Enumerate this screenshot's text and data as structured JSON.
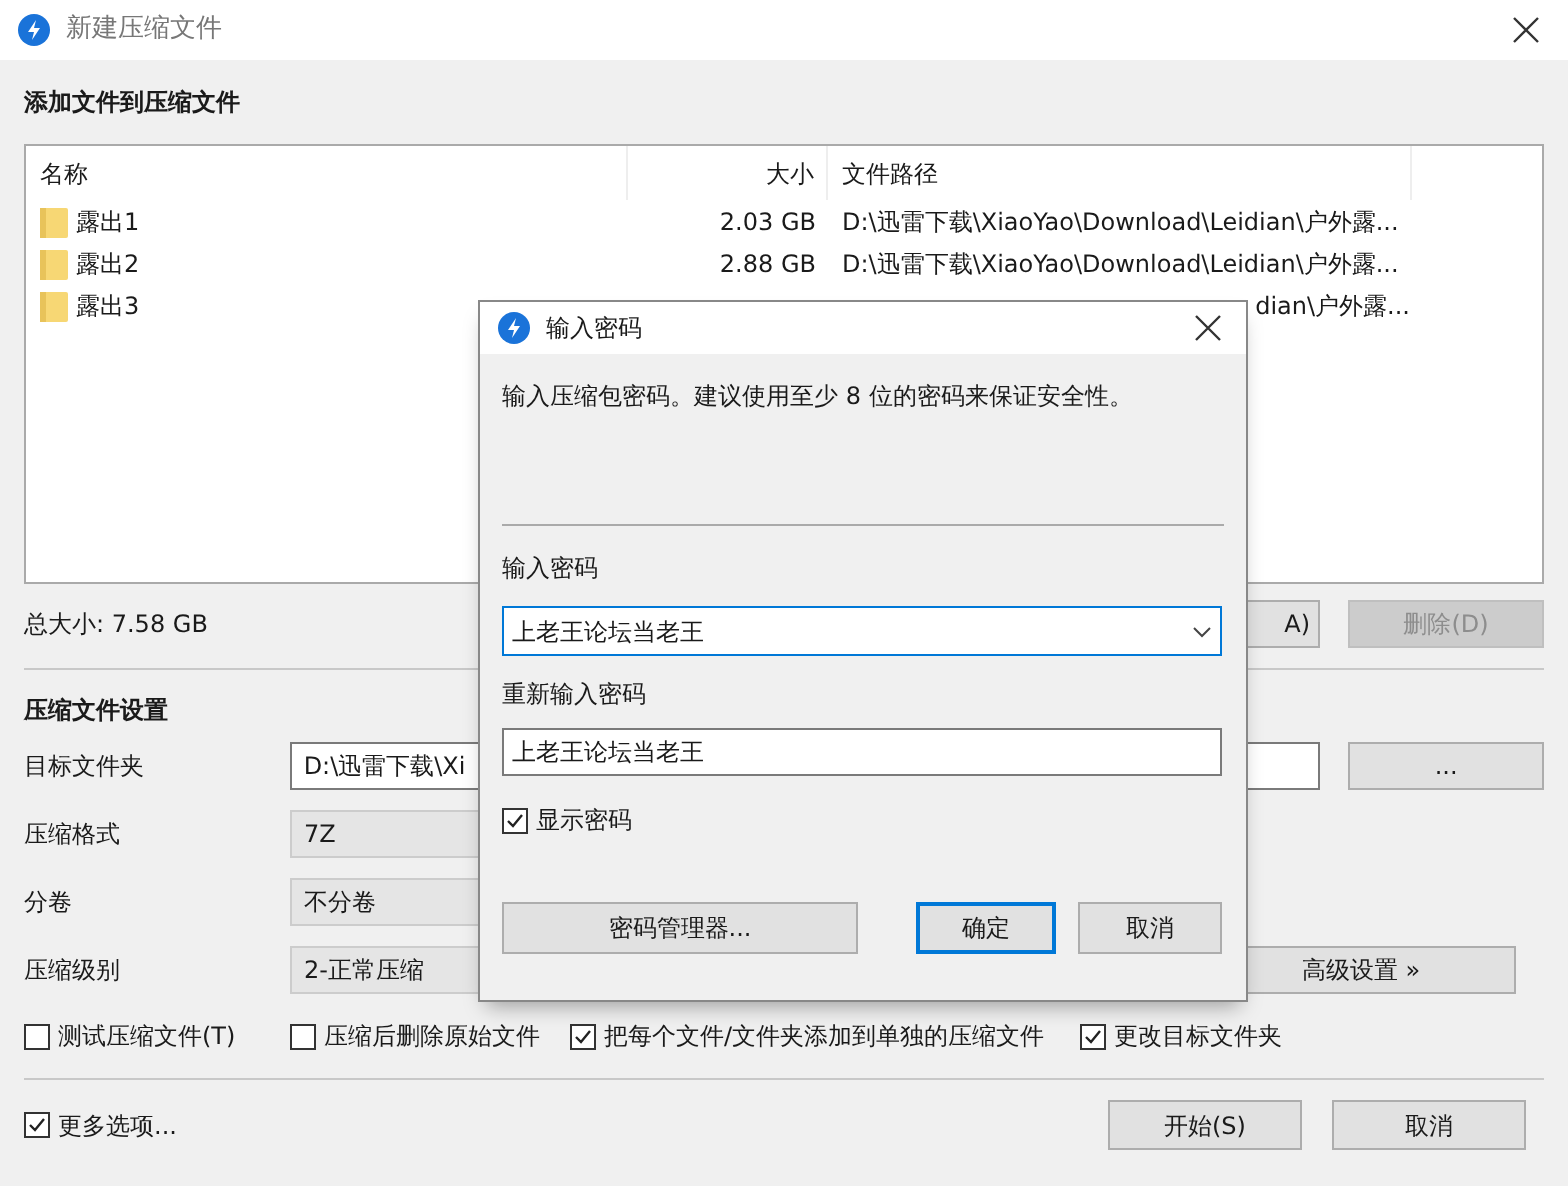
{
  "window": {
    "title": "新建压缩文件"
  },
  "files_section": {
    "heading": "添加文件到压缩文件",
    "columns": [
      "名称",
      "大小",
      "文件路径"
    ],
    "rows": [
      {
        "kind": "full",
        "name": "露出1",
        "size": "2.03 GB",
        "path": "D:\\迅雷下载\\XiaoYao\\Download\\Leidian\\户外露..."
      },
      {
        "kind": "full",
        "name": "露出2",
        "size": "2.88 GB",
        "path": "D:\\迅雷下载\\XiaoYao\\Download\\Leidian\\户外露..."
      },
      {
        "kind": "partial",
        "name": "露出3",
        "path": "dian\\户外露..."
      }
    ]
  },
  "total_size": "总大小: 7.58 GB",
  "list_buttons": [
    {
      "label": "A)",
      "disabled": false
    },
    {
      "label": "删除(D)",
      "disabled": true
    }
  ],
  "settings": {
    "heading": "压缩文件设置",
    "fields": [
      {
        "label": "目标文件夹",
        "kind": "text",
        "value": "D:\\迅雷下载\\Xi"
      },
      {
        "label": "压缩格式",
        "kind": "select",
        "value": "7Z"
      },
      {
        "label": "分卷",
        "kind": "select",
        "value": "不分卷"
      },
      {
        "label": "压缩级别",
        "kind": "select",
        "value": "2-正常压缩"
      }
    ],
    "browse_button": "...",
    "advanced_button": "高级设置 »"
  },
  "options": [
    {
      "label": "测试压缩文件(T)",
      "checked": false
    },
    {
      "label": "压缩后删除原始文件",
      "checked": false
    },
    {
      "label": "把每个文件/文件夹添加到单独的压缩文件",
      "checked": true
    },
    {
      "label": "更改目标文件夹",
      "checked": true
    }
  ],
  "more_options": {
    "label": "更多选项...",
    "checked": true
  },
  "buttons": [
    "开始(S)",
    "取消"
  ],
  "dialog": {
    "title": "输入密码",
    "message": "输入压缩包密码。建议使用至少 8 位的密码来保证安全性。",
    "password_label": "输入密码",
    "password_value": "上老王论坛当老王",
    "repeat_label": "重新输入密码",
    "repeat_value": "上老王论坛当老王",
    "show_password": {
      "label": "显示密码",
      "checked": true
    },
    "buttons": [
      {
        "label": "密码管理器...",
        "default": false
      },
      {
        "label": "确定",
        "default": true
      },
      {
        "label": "取消",
        "default": false
      }
    ]
  }
}
